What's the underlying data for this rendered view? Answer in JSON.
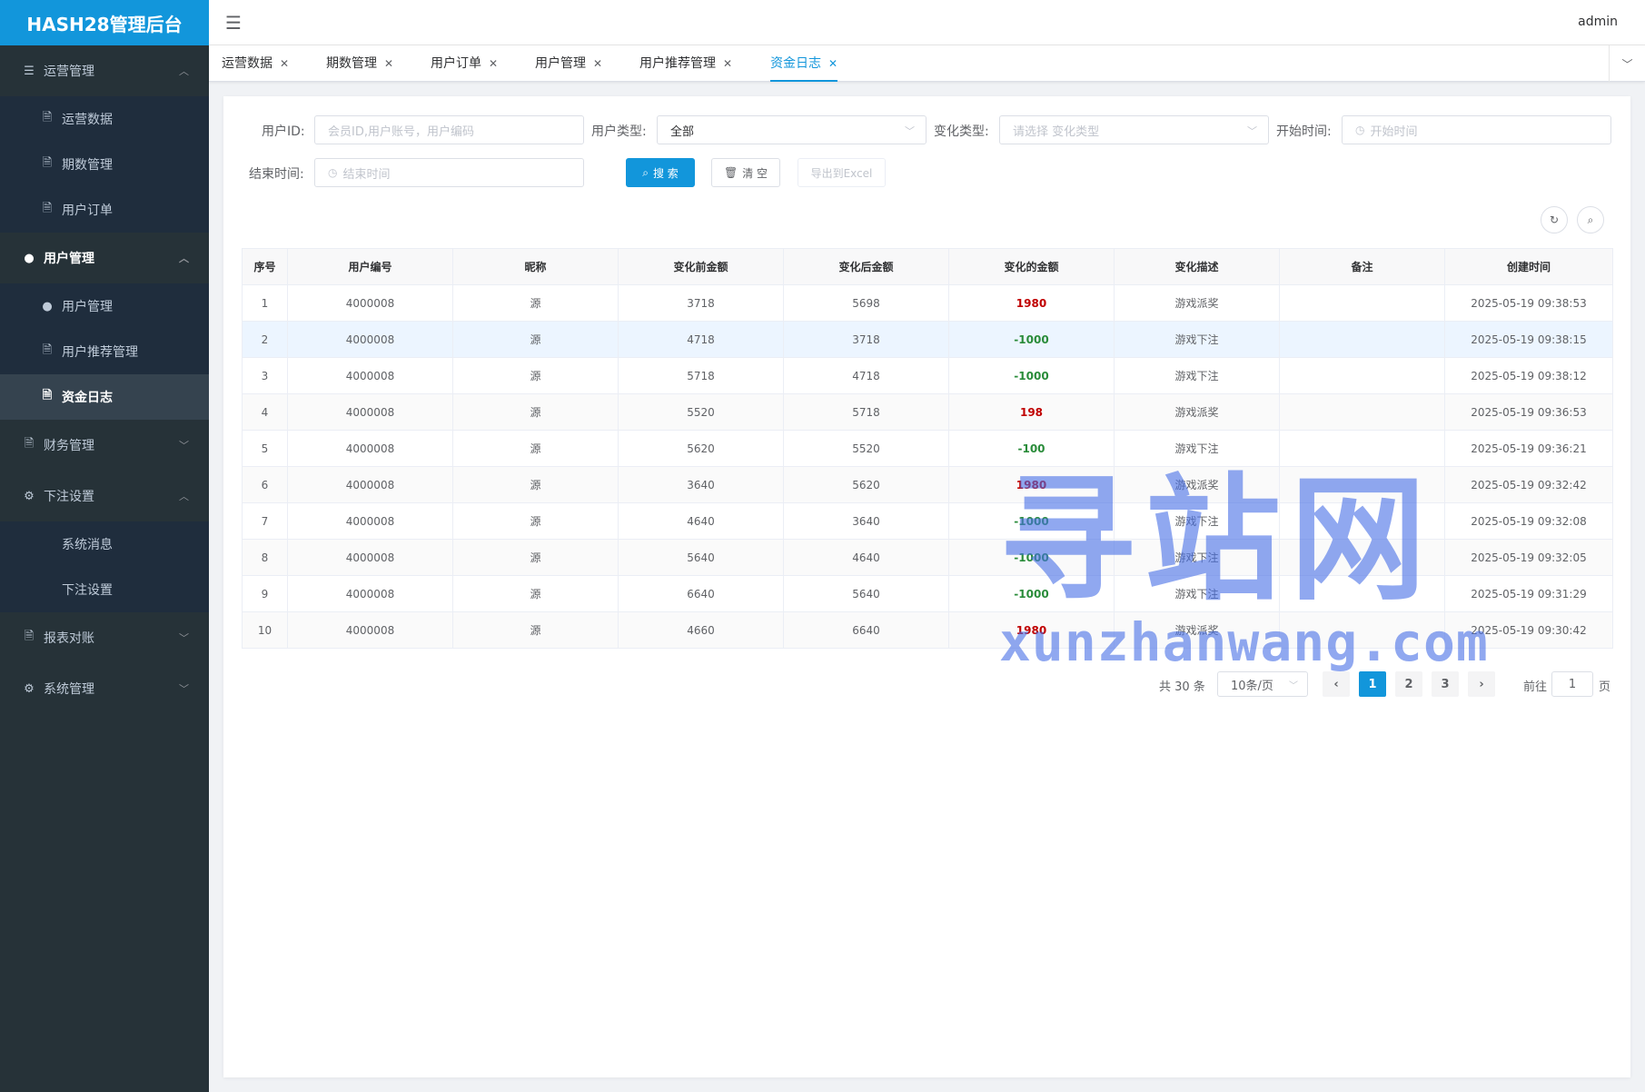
{
  "app": {
    "title": "HASH28管理后台",
    "user": "admin"
  },
  "sidebar": {
    "groups": [
      {
        "label": "运营管理",
        "items": [
          {
            "label": "运营数据"
          },
          {
            "label": "期数管理"
          },
          {
            "label": "用户订单"
          }
        ]
      },
      {
        "label": "用户管理",
        "items": [
          {
            "label": "用户管理"
          },
          {
            "label": "用户推荐管理"
          },
          {
            "label": "资金日志"
          }
        ]
      },
      {
        "label": "财务管理",
        "items": []
      },
      {
        "label": "下注设置",
        "items": [
          {
            "label": "系统消息"
          },
          {
            "label": "下注设置"
          }
        ]
      },
      {
        "label": "报表对账",
        "items": []
      },
      {
        "label": "系统管理",
        "items": []
      }
    ]
  },
  "tabs": [
    {
      "label": "运营数据"
    },
    {
      "label": "期数管理"
    },
    {
      "label": "用户订单"
    },
    {
      "label": "用户管理"
    },
    {
      "label": "用户推荐管理"
    },
    {
      "label": "资金日志"
    }
  ],
  "filters": {
    "user_id": {
      "label": "用户ID:",
      "placeholder": "会员ID,用户账号，用户编码"
    },
    "user_type": {
      "label": "用户类型:",
      "value": "全部"
    },
    "change_type": {
      "label": "变化类型:",
      "placeholder": "请选择 变化类型"
    },
    "start_time": {
      "label": "开始时间:",
      "placeholder": "开始时间"
    },
    "end_time": {
      "label": "结束时间:",
      "placeholder": "结束时间"
    }
  },
  "buttons": {
    "search": "搜 索",
    "clear": "清 空",
    "export": "导出到Excel"
  },
  "table": {
    "columns": [
      "序号",
      "用户编号",
      "昵称",
      "变化前金额",
      "变化后金额",
      "变化的金额",
      "变化描述",
      "备注",
      "创建时间"
    ],
    "rows": [
      [
        "1",
        "4000008",
        "源",
        "3718",
        "5698",
        "1980",
        "游戏派奖",
        "",
        "2025-05-19 09:38:53"
      ],
      [
        "2",
        "4000008",
        "源",
        "4718",
        "3718",
        "-1000",
        "游戏下注",
        "",
        "2025-05-19 09:38:15"
      ],
      [
        "3",
        "4000008",
        "源",
        "5718",
        "4718",
        "-1000",
        "游戏下注",
        "",
        "2025-05-19 09:38:12"
      ],
      [
        "4",
        "4000008",
        "源",
        "5520",
        "5718",
        "198",
        "游戏派奖",
        "",
        "2025-05-19 09:36:53"
      ],
      [
        "5",
        "4000008",
        "源",
        "5620",
        "5520",
        "-100",
        "游戏下注",
        "",
        "2025-05-19 09:36:21"
      ],
      [
        "6",
        "4000008",
        "源",
        "3640",
        "5620",
        "1980",
        "游戏派奖",
        "",
        "2025-05-19 09:32:42"
      ],
      [
        "7",
        "4000008",
        "源",
        "4640",
        "3640",
        "-1000",
        "游戏下注",
        "",
        "2025-05-19 09:32:08"
      ],
      [
        "8",
        "4000008",
        "源",
        "5640",
        "4640",
        "-1000",
        "游戏下注",
        "",
        "2025-05-19 09:32:05"
      ],
      [
        "9",
        "4000008",
        "源",
        "6640",
        "5640",
        "-1000",
        "游戏下注",
        "",
        "2025-05-19 09:31:29"
      ],
      [
        "10",
        "4000008",
        "源",
        "4660",
        "6640",
        "1980",
        "游戏派奖",
        "",
        "2025-05-19 09:30:42"
      ]
    ]
  },
  "pagination": {
    "total": "共 30 条",
    "page_size": "10条/页",
    "pages": [
      "1",
      "2",
      "3"
    ],
    "current": "1",
    "goto_prefix": "前往",
    "goto_value": "1",
    "goto_suffix": "页"
  },
  "watermark": {
    "big": "寻站网",
    "small": "xunzhanwang.com"
  },
  "colors": {
    "primary": "#1296db",
    "sidebar": "#263238",
    "positive": "#c00000",
    "negative": "#2a8c3a"
  }
}
